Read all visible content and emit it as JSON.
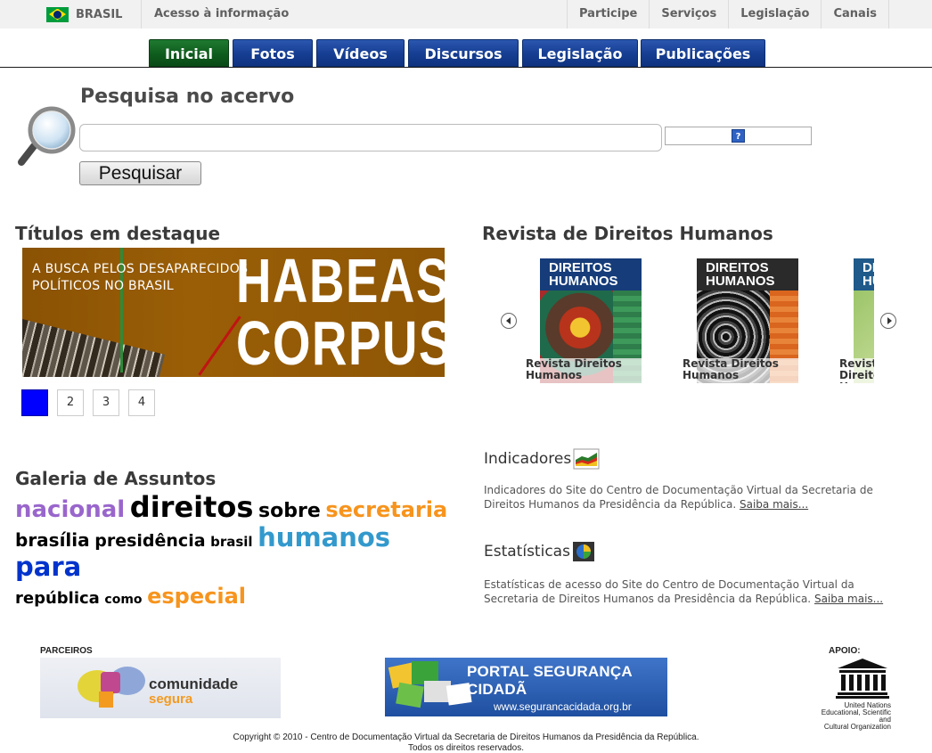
{
  "govbar": {
    "country": "BRASIL",
    "access_info": "Acesso à informação",
    "links": [
      "Participe",
      "Serviços",
      "Legislação",
      "Canais"
    ]
  },
  "tabs": [
    {
      "label": "Inicial",
      "active": true
    },
    {
      "label": "Fotos",
      "active": false
    },
    {
      "label": "Vídeos",
      "active": false
    },
    {
      "label": "Discursos",
      "active": false
    },
    {
      "label": "Legislação",
      "active": false
    },
    {
      "label": "Publicações",
      "active": false
    }
  ],
  "search": {
    "title": "Pesquisa no acervo",
    "value": "",
    "button_label": "Pesquisar",
    "help_glyph": "?"
  },
  "featured": {
    "title": "Títulos em destaque",
    "banner_subtitle": [
      "A BUSCA PELOS DESAPARECIDOS",
      "POLÍTICOS NO BRASIL"
    ],
    "banner_title": [
      "HABEAS",
      "CORPUS"
    ],
    "pages": [
      "1",
      "2",
      "3",
      "4"
    ],
    "active_page": 1
  },
  "magazine": {
    "title": "Revista de Direitos Humanos",
    "cover_head": [
      "DIREITOS",
      "HUMANOS"
    ],
    "items": [
      {
        "caption": "Revista Direitos Humanos"
      },
      {
        "caption": "Revista Direitos Humanos"
      },
      {
        "caption": "Revista Direitos Humanos"
      }
    ]
  },
  "indicators": {
    "title": "Indicadores",
    "text": "Indicadores do Site do Centro de Documentação Virtual da Secretaria de Direitos Humanos da Presidência da República.",
    "link": "Saiba mais..."
  },
  "statistics": {
    "title": "Estatísticas",
    "text": "Estatísticas de acesso do Site do Centro de Documentação Virtual da Secretaria de Direitos Humanos da Presidência da República.",
    "link": "Saiba mais..."
  },
  "gallery": {
    "title": "Galeria de Assuntos",
    "tags": [
      {
        "text": "nacional",
        "color": "#9966cc"
      },
      {
        "text": "direitos",
        "color": "#000000"
      },
      {
        "text": "sobre",
        "color": "#000000"
      },
      {
        "text": "secretaria",
        "color": "#f7941d"
      },
      {
        "text": "brasília",
        "color": "#000000"
      },
      {
        "text": "presidência",
        "color": "#000000"
      },
      {
        "text": "brasil",
        "color": "#000000"
      },
      {
        "text": "humanos",
        "color": "#3399cc"
      },
      {
        "text": "para",
        "color": "#0033cc"
      },
      {
        "text": "república",
        "color": "#000000"
      },
      {
        "text": "como",
        "color": "#000000"
      },
      {
        "text": "especial",
        "color": "#f7941d"
      }
    ]
  },
  "footer": {
    "partners_label": "PARCEIROS",
    "support_label": "APOIO:",
    "comunidade": [
      "comunidade",
      "segura"
    ],
    "portal": [
      "PORTAL SEGURANÇA CIDADÃ",
      "www.segurancacidada.org.br"
    ],
    "unesco": [
      "UNESCO",
      "United Nations",
      "Educational, Scientific and",
      "Cultural Organization"
    ],
    "copyright": [
      "Copyright © 2010 - Centro de Documentação Virtual da Secretaria de Direitos Humanos da Presidência da República.",
      "Todos os direitos reservados."
    ]
  },
  "colors": {
    "tab_blue": "#153d91",
    "tab_green": "#0e5c1d",
    "pager_active": "#0000ff",
    "banner_brown": "#9a5e06"
  }
}
